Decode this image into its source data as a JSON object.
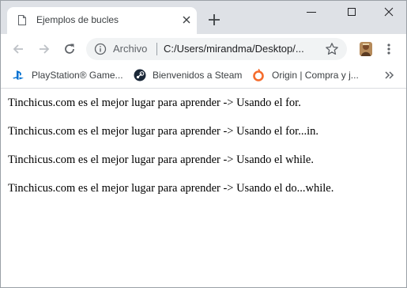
{
  "tab": {
    "title": "Ejemplos de bucles"
  },
  "omnibox": {
    "scheme_label": "Archivo",
    "url": "C:/Users/mirandma/Desktop/..."
  },
  "bookmarks": [
    {
      "label": "PlayStation® Game...",
      "icon": "playstation-icon",
      "color": "#0070d1"
    },
    {
      "label": "Bienvenidos a Steam",
      "icon": "steam-icon",
      "color": "#1b2838"
    },
    {
      "label": "Origin | Compra y j...",
      "icon": "origin-icon",
      "color": "#f56c2d"
    }
  ],
  "content": {
    "lines": [
      "Tinchicus.com es el mejor lugar para aprender -> Usando el for.",
      "Tinchicus.com es el mejor lugar para aprender -> Usando el for...in.",
      "Tinchicus.com es el mejor lugar para aprender -> Usando el while.",
      "Tinchicus.com es el mejor lugar para aprender -> Usando el do...while."
    ]
  }
}
